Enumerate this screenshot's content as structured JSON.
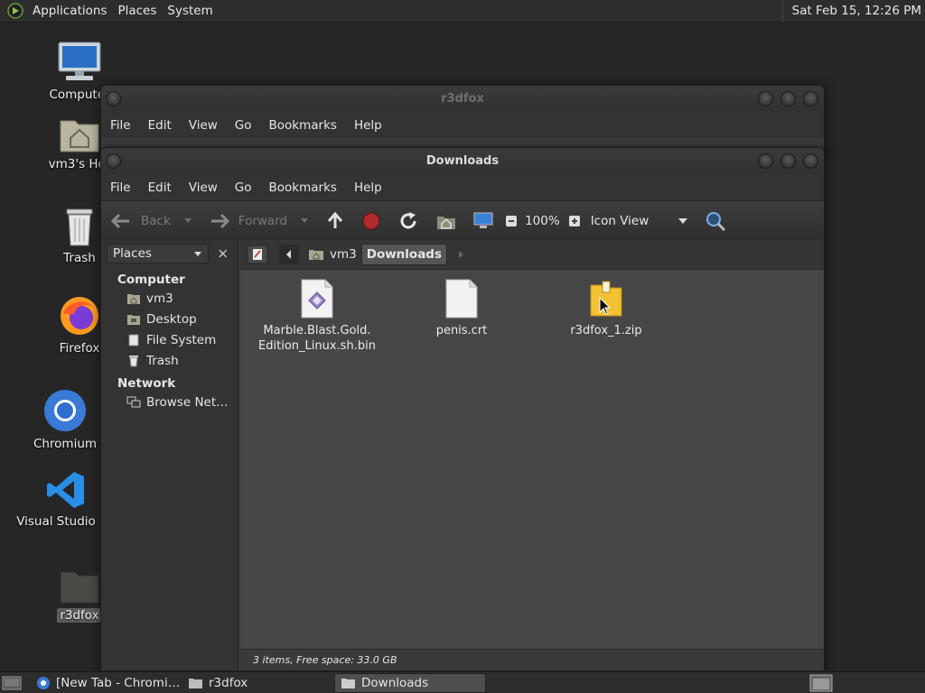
{
  "top_panel": {
    "menus": [
      "Applications",
      "Places",
      "System"
    ],
    "clock": "Sat Feb 15, 12:26 PM"
  },
  "desktop": {
    "icons": [
      {
        "label": "Computer"
      },
      {
        "label": "vm3's Hor"
      },
      {
        "label": "Trash"
      },
      {
        "label": "Firefox"
      },
      {
        "label": "Chromium"
      },
      {
        "label": "Visual Studio Co"
      },
      {
        "label": "r3dfox"
      }
    ]
  },
  "back_window": {
    "title": "r3dfox",
    "menus": [
      "File",
      "Edit",
      "View",
      "Go",
      "Bookmarks",
      "Help"
    ]
  },
  "main_window": {
    "title": "Downloads",
    "menus": [
      "File",
      "Edit",
      "View",
      "Go",
      "Bookmarks",
      "Help"
    ],
    "toolbar": {
      "back": "Back",
      "forward": "Forward",
      "zoom": "100%",
      "view_mode": "Icon View"
    },
    "sidebar": {
      "selector": "Places",
      "sections": [
        {
          "title": "Computer",
          "items": [
            "vm3",
            "Desktop",
            "File System",
            "Trash"
          ]
        },
        {
          "title": "Network",
          "items": [
            "Browse Net…"
          ]
        }
      ]
    },
    "path": [
      "vm3",
      "Downloads"
    ],
    "files": [
      {
        "name": "Marble.Blast.Gold.",
        "name2": "Edition_Linux.sh.bin",
        "type": "executable-icon"
      },
      {
        "name": "penis.crt",
        "name2": "",
        "type": "document-icon"
      },
      {
        "name": "r3dfox_1.zip",
        "name2": "",
        "type": "archive-icon"
      }
    ],
    "status": "3 items, Free space: 33.0 GB"
  },
  "taskbar": {
    "tasks": [
      "[New Tab - Chromi…",
      "r3dfox",
      "Downloads"
    ]
  }
}
